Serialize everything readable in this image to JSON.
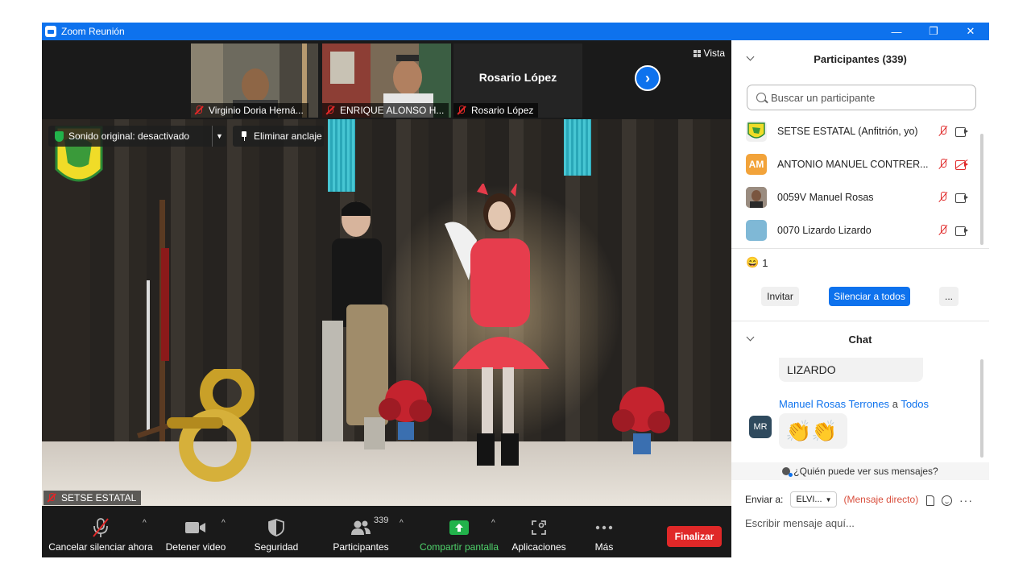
{
  "window": {
    "title": "Zoom Reunión",
    "minimize": "—",
    "restore": "❐",
    "close": "✕"
  },
  "thumbnails": [
    {
      "name": "Virginio Doria Herná..."
    },
    {
      "name": "ENRIQUE ALONSO H..."
    },
    {
      "name": "Rosario López",
      "display_name": "Rosario López"
    }
  ],
  "view_button": "Vista",
  "main_video": {
    "original_sound": "Sonido original: desactivado",
    "unpin": "Eliminar anclaje",
    "speaker": "SETSE ESTATAL"
  },
  "toolbar": {
    "mute": "Cancelar silenciar ahora",
    "video": "Detener video",
    "security": "Seguridad",
    "participants": "Participantes",
    "participants_count": "339",
    "share": "Compartir pantalla",
    "apps": "Aplicaciones",
    "more": "Más",
    "end": "Finalizar"
  },
  "participants_panel": {
    "title": "Participantes (339)",
    "search_placeholder": "Buscar un participante",
    "items": [
      {
        "name": "SETSE ESTATAL (Anfitrión, yo)",
        "avatar": ""
      },
      {
        "name": "ANTONIO MANUEL CONTRER...",
        "avatar": "AM",
        "avatar_color": "#f2a33a"
      },
      {
        "name": "0059V Manuel Rosas",
        "avatar": ""
      },
      {
        "name": "0070 Lizardo Lizardo",
        "avatar": ""
      }
    ],
    "reaction_emoji": "😄",
    "reaction_count": "1",
    "invite": "Invitar",
    "mute_all": "Silenciar a todos",
    "more": "..."
  },
  "chat": {
    "title": "Chat",
    "prev_message": "LIZARDO",
    "sender": "Manuel Rosas Terrones",
    "to_word": "a",
    "recipient": "Todos",
    "sender_initials": "MR",
    "message": "👏👏",
    "who_can_see": "¿Quién puede ver sus mensajes?",
    "send_to_label": "Enviar a:",
    "send_to_value": "ELVI...",
    "direct_label": "(Mensaje directo)",
    "input_placeholder": "Escribir mensaje aquí..."
  },
  "colors": {
    "accent": "#0e72ed",
    "danger": "#e02828",
    "share_green": "#22b34b"
  }
}
